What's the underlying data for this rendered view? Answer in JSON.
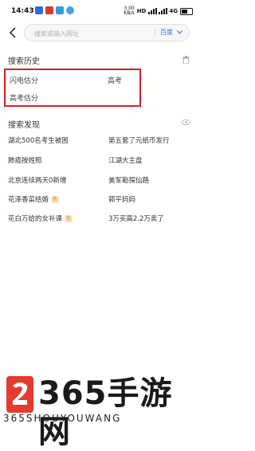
{
  "status_bar": {
    "time": "14:43",
    "net_speed": "3.00",
    "net_unit": "KB/s",
    "network": "HD",
    "signal_type": "4G",
    "battery_icon": "battery-icon"
  },
  "search": {
    "placeholder": "搜索或输入网址",
    "engine_label": "百度",
    "back_icon": "chevron-left-icon"
  },
  "history": {
    "title": "搜索历史",
    "clear_icon": "trash-icon",
    "items": [
      "闪电估分",
      "高考",
      "高考估分"
    ]
  },
  "discover": {
    "title": "搜索发现",
    "toggle_icon": "eye-icon",
    "hot_label": "热",
    "items": [
      {
        "text": "湖北500名考生被困",
        "hot": false
      },
      {
        "text": "第五套了元纸币发行",
        "hot": false
      },
      {
        "text": "肺癌按姓照",
        "hot": false
      },
      {
        "text": "江湖大主盘",
        "hot": false
      },
      {
        "text": "北京连续两天0新增",
        "hot": false
      },
      {
        "text": "美军勘探仙路",
        "hot": false
      },
      {
        "text": "花泽香菜结婚",
        "hot": true
      },
      {
        "text": "郭平妈妈",
        "hot": false
      },
      {
        "text": "花白万给的女补课",
        "hot": true
      },
      {
        "text": "3万买高2.2万卖了",
        "hot": false
      }
    ]
  },
  "watermark": {
    "title": "365手游网",
    "subtitle": "365SHOUYOUWANG",
    "logo_icon": "365-logo-icon"
  }
}
